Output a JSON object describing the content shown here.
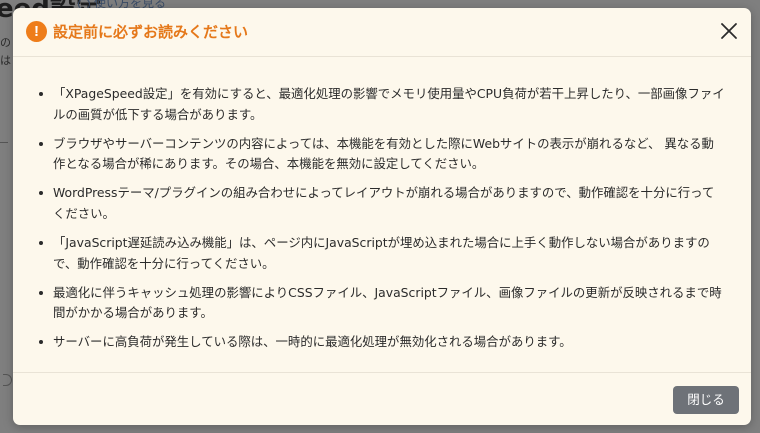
{
  "background": {
    "title_fragment": "eed設定",
    "link_text": "使い方を見る",
    "side_fragment_a": "の",
    "side_fragment_b": "は"
  },
  "modal": {
    "title": "設定前に必ずお読みください",
    "warning_glyph": "!",
    "notes": [
      "「XPageSpeed設定」を有効にすると、最適化処理の影響でメモリ使用量やCPU負荷が若干上昇したり、一部画像ファイルの画質が低下する場合があります。",
      "ブラウザやサーバーコンテンツの内容によっては、本機能を有効とした際にWebサイトの表示が崩れるなど、 異なる動作となる場合が稀にあります。その場合、本機能を無効に設定してください。",
      "WordPressテーマ/プラグインの組み合わせによってレイアウトが崩れる場合がありますので、動作確認を十分に行ってください。",
      "「JavaScript遅延読み込み機能」は、ページ内にJavaScriptが埋め込まれた場合に上手く動作しない場合がありますので、動作確認を十分に行ってください。",
      "最適化に伴うキャッシュ処理の影響によりCSSファイル、JavaScriptファイル、画像ファイルの更新が反映されるまで時間がかかる場合があります。",
      "サーバーに高負荷が発生している際は、一時的に最適化処理が無効化される場合があります。"
    ],
    "close_button_label": "閉じる"
  },
  "colors": {
    "accent_orange": "#e5781a",
    "modal_background": "#fdf8ec",
    "button_gray": "#6e7278"
  },
  "icons": {
    "header": "warning-circle-icon",
    "close": "close-icon"
  }
}
